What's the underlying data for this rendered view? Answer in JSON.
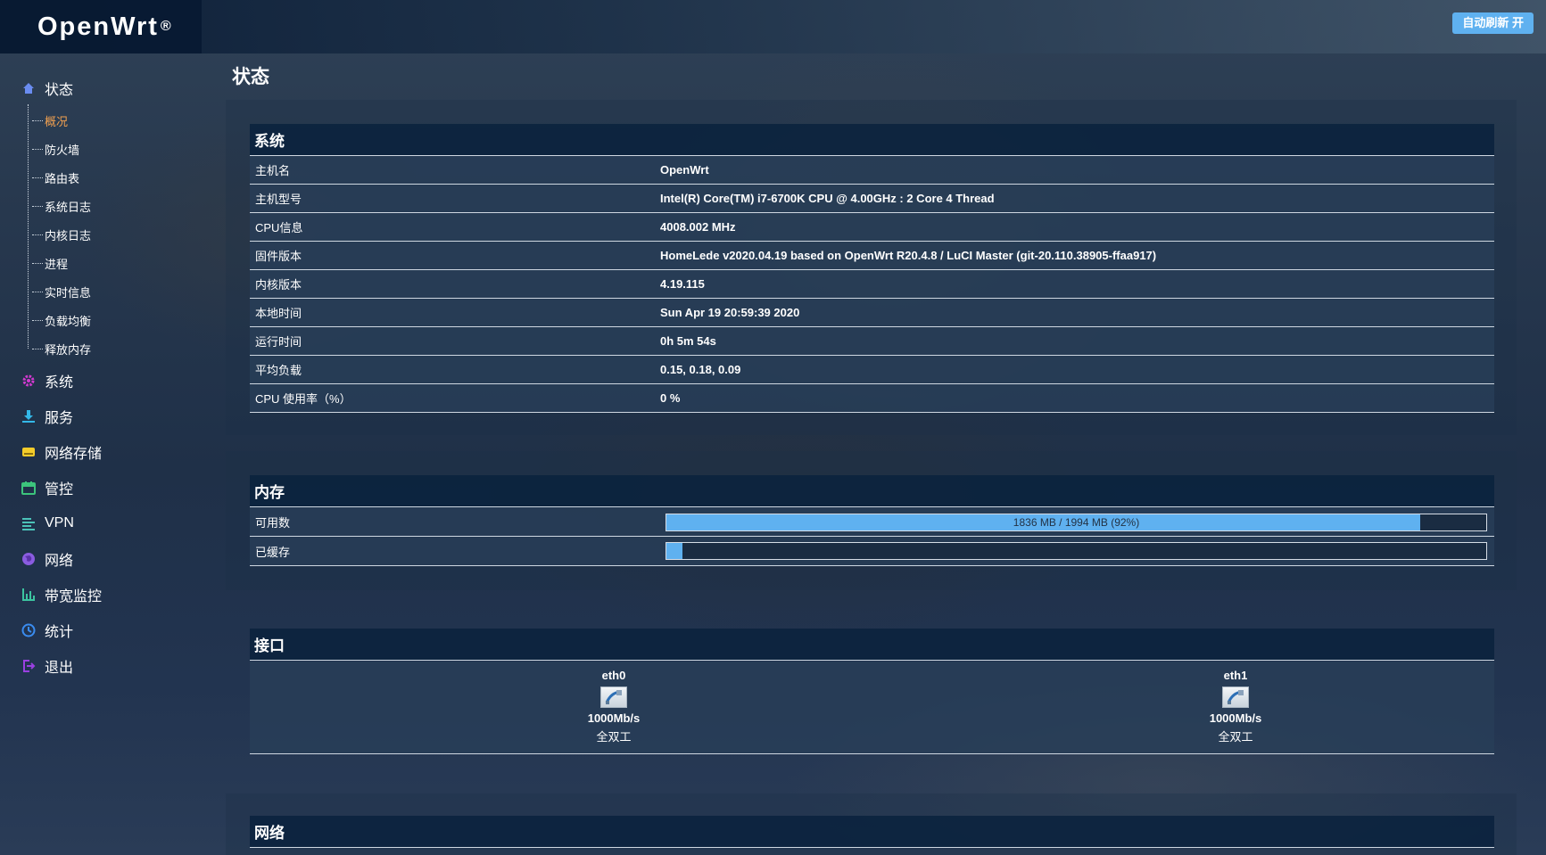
{
  "header": {
    "brand": "OpenWrt",
    "brand_mark": "®",
    "refresh_button": "自动刷新 开"
  },
  "sidebar": {
    "status": {
      "label": "状态",
      "icon": "home-icon"
    },
    "sub_items": [
      "概况",
      "防火墙",
      "路由表",
      "系统日志",
      "内核日志",
      "进程",
      "实时信息",
      "负载均衡",
      "释放内存"
    ],
    "active_sub": "概况",
    "items": [
      {
        "label": "系统",
        "icon": "gear-icon"
      },
      {
        "label": "服务",
        "icon": "download-icon"
      },
      {
        "label": "网络存储",
        "icon": "storage-icon"
      },
      {
        "label": "管控",
        "icon": "calendar-icon"
      },
      {
        "label": "VPN",
        "icon": "lines-icon"
      },
      {
        "label": "网络",
        "icon": "globe-icon"
      },
      {
        "label": "带宽监控",
        "icon": "bar-chart-icon"
      },
      {
        "label": "统计",
        "icon": "clock-icon"
      },
      {
        "label": "退出",
        "icon": "logout-icon"
      }
    ]
  },
  "page": {
    "title": "状态"
  },
  "system": {
    "title": "系统",
    "rows": [
      {
        "k": "主机名",
        "v": "OpenWrt"
      },
      {
        "k": "主机型号",
        "v": "Intel(R) Core(TM) i7-6700K CPU @ 4.00GHz : 2 Core 4 Thread"
      },
      {
        "k": "CPU信息",
        "v": "4008.002 MHz"
      },
      {
        "k": "固件版本",
        "v": "HomeLede v2020.04.19 based on OpenWrt R20.4.8 / LuCI Master (git-20.110.38905-ffaa917)"
      },
      {
        "k": "内核版本",
        "v": "4.19.115"
      },
      {
        "k": "本地时间",
        "v": "Sun Apr 19 20:59:39 2020"
      },
      {
        "k": "运行时间",
        "v": "0h 5m 54s"
      },
      {
        "k": "平均负载",
        "v": "0.15, 0.18, 0.09"
      },
      {
        "k": "CPU 使用率（%）",
        "v": "0 %"
      }
    ]
  },
  "memory": {
    "title": "内存",
    "available": {
      "label": "可用数",
      "text": "1836 MB / 1994 MB (92%)",
      "fraction": 0.92
    },
    "cached": {
      "label": "已缓存",
      "text": "",
      "fraction": 0.02
    }
  },
  "interfaces": {
    "title": "接口",
    "items": [
      {
        "name": "eth0",
        "speed": "1000Mb/s",
        "duplex": "全双工",
        "icon": "ethernet-port-icon"
      },
      {
        "name": "eth1",
        "speed": "1000Mb/s",
        "duplex": "全双工",
        "icon": "ethernet-port-icon"
      }
    ]
  },
  "network": {
    "title": "网络"
  }
}
